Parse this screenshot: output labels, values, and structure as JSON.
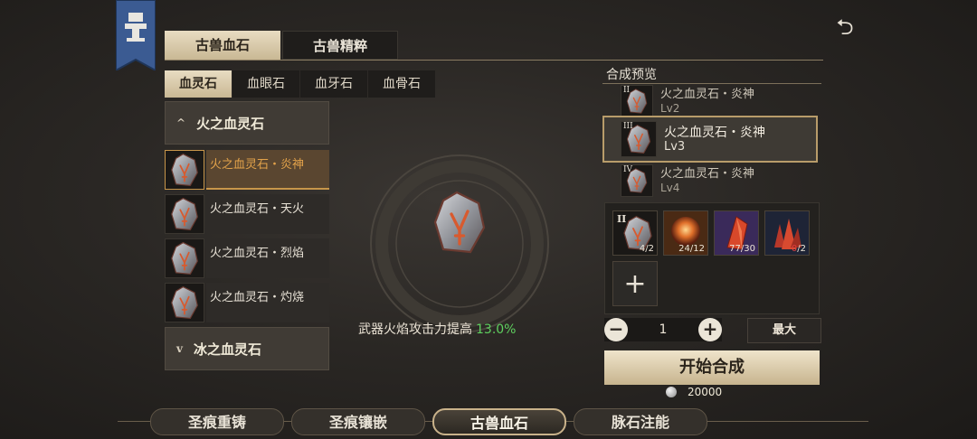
{
  "top_tabs": [
    {
      "label": "古兽血石"
    },
    {
      "label": "古兽精粹"
    }
  ],
  "sub_tabs": [
    {
      "label": "血灵石"
    },
    {
      "label": "血眼石"
    },
    {
      "label": "血牙石"
    },
    {
      "label": "血骨石"
    }
  ],
  "list": {
    "category1": {
      "chevron": "^",
      "label": "火之血灵石"
    },
    "items": [
      {
        "label": "火之血灵石・炎神",
        "icon": "fire-blood-stone-icon"
      },
      {
        "label": "火之血灵石・天火",
        "icon": "fire-blood-stone-icon"
      },
      {
        "label": "火之血灵石・烈焰",
        "icon": "fire-blood-stone-icon"
      },
      {
        "label": "火之血灵石・灼烧",
        "icon": "fire-blood-stone-icon"
      }
    ],
    "category2": {
      "chevron": "v",
      "label": "冰之血灵石"
    }
  },
  "center": {
    "bonus_text": "武器火焰攻击力提高",
    "bonus_value": "13.0%"
  },
  "preview": {
    "title": "合成预览",
    "rows": [
      {
        "roman": "II",
        "name": "火之血灵石・炎神",
        "level": "Lv2"
      },
      {
        "roman": "III",
        "name": "火之血灵石・炎神",
        "level": "Lv3"
      },
      {
        "roman": "IV",
        "name": "火之血灵石・炎神",
        "level": "Lv4"
      }
    ]
  },
  "materials": [
    {
      "roman": "II",
      "have": "4",
      "need": "2",
      "icon": "blood-stone-icon"
    },
    {
      "have": "24",
      "need": "12",
      "icon": "fire-orb-icon"
    },
    {
      "have": "77",
      "need": "30",
      "icon": "red-crystal-shard-icon"
    },
    {
      "have": "0",
      "need": "2",
      "icon": "red-crystal-cluster-icon"
    }
  ],
  "add_material": "+",
  "quantity": {
    "minus": "−",
    "value": "1",
    "plus": "+"
  },
  "max_label": "最大",
  "start_label": "开始合成",
  "cost": "20000",
  "back_glyph": "⮌",
  "bottom_nav": [
    {
      "label": "圣痕重铸"
    },
    {
      "label": "圣痕镶嵌"
    },
    {
      "label": "古兽血石"
    },
    {
      "label": "脉石注能"
    }
  ],
  "colors": {
    "accent": "#c8964a",
    "bonus": "#5fd05f",
    "shortage": "#e04040"
  }
}
